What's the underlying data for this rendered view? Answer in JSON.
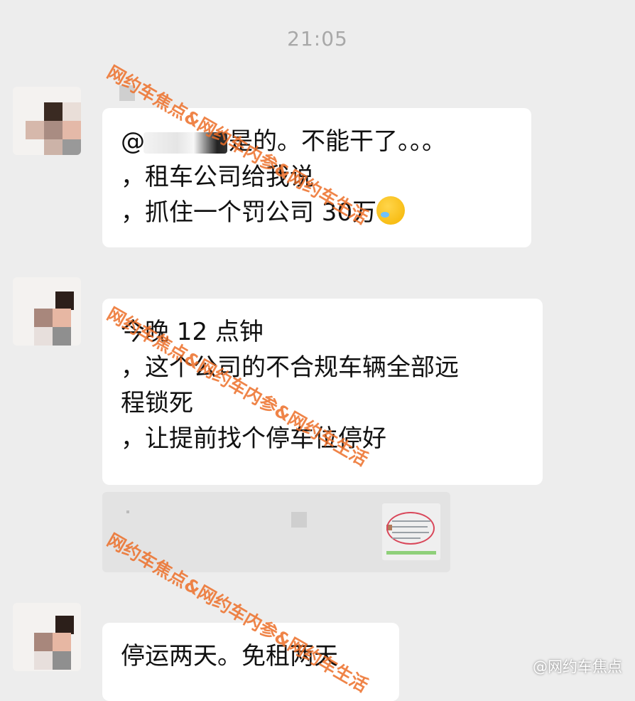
{
  "header": {
    "time": "21:05"
  },
  "messages": [
    {
      "lines": [
        {
          "prefix": "@",
          "suffix": "是的。不能干了。。。"
        },
        {
          "text": "，租车公司给我说"
        },
        {
          "text": "，抓住一个罚公司 30万"
        }
      ],
      "emoji": "crying-face-emoji"
    },
    {
      "lines": [
        {
          "text": "今晚 12 点钟"
        },
        {
          "text": "，这个公司的不合规车辆全部远"
        },
        {
          "text": "程锁死"
        },
        {
          "text": "，让提前找个停车位停好"
        }
      ]
    },
    {
      "lines": [
        {
          "text": "停运两天。免租两天"
        }
      ]
    }
  ],
  "watermark": {
    "text": "网约车焦点&网约车内参&网约车生活",
    "corner": "@网约车焦点"
  },
  "colors": {
    "background": "#ededed",
    "bubble": "#ffffff",
    "watermark": "#ec6e28"
  }
}
